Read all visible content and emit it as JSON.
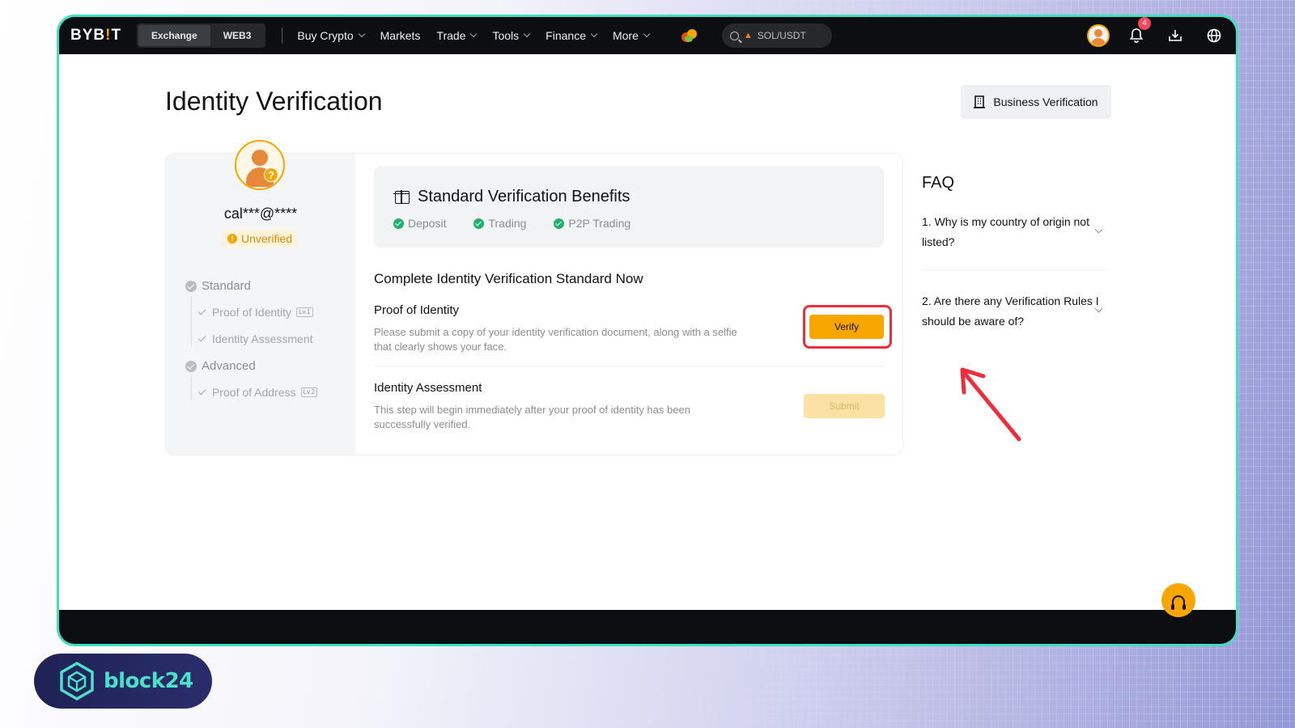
{
  "nav": {
    "logo_prefix": "BYB",
    "logo_bang": "!",
    "logo_suffix": "T",
    "segments": [
      "Exchange",
      "WEB3"
    ],
    "items": [
      "Buy Crypto",
      "Markets",
      "Trade",
      "Tools",
      "Finance",
      "More"
    ],
    "search_value": "SOL/USDT",
    "notification_count": "4"
  },
  "page": {
    "title": "Identity Verification",
    "business_button": "Business Verification"
  },
  "profile": {
    "email": "cal***@****",
    "status": "Unverified"
  },
  "steps": {
    "standard": "Standard",
    "standard_subs": [
      {
        "label": "Proof of Identity",
        "level": "Lv.1"
      },
      {
        "label": "Identity Assessment",
        "level": ""
      }
    ],
    "advanced": "Advanced",
    "advanced_subs": [
      {
        "label": "Proof of Address",
        "level": "Lv.2"
      }
    ]
  },
  "benefits": {
    "title": "Standard Verification Benefits",
    "items": [
      "Deposit",
      "Trading",
      "P2P Trading"
    ]
  },
  "main": {
    "section_title": "Complete Identity Verification Standard Now",
    "proof_title": "Proof of Identity",
    "proof_desc": "Please submit a copy of your identity verification document, along with a selfie that clearly shows your face.",
    "verify_button": "Verify",
    "assessment_title": "Identity Assessment",
    "assessment_desc": "This step will begin immediately after your proof of identity has been successfully verified.",
    "submit_button": "Submit"
  },
  "faq": {
    "title": "FAQ",
    "items": [
      "1. Why is my country of origin not listed?",
      "2. Are there any Verification Rules I should be aware of?"
    ]
  },
  "watermark": {
    "brand": "block24"
  },
  "colors": {
    "accent": "#f7a600",
    "highlight": "#ee2e3a",
    "frame": "#3ee0c2",
    "success": "#20b26c"
  }
}
